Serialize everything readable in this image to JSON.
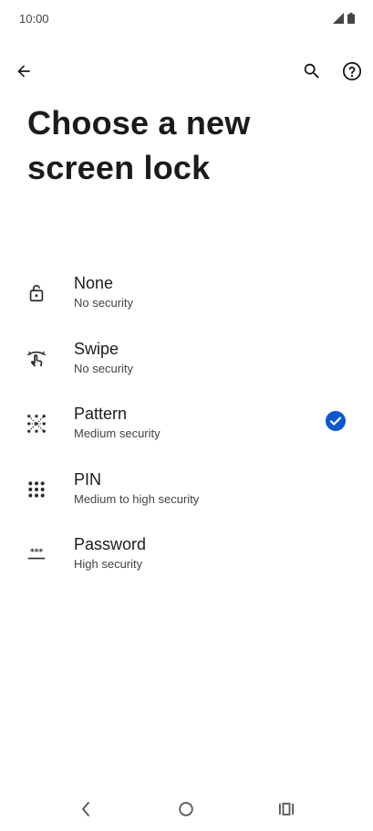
{
  "status_bar": {
    "time": "10:00",
    "icons": [
      "signal-icon",
      "battery-icon"
    ]
  },
  "app_bar": {
    "back_icon": "arrow-back-icon",
    "search_icon": "search-icon",
    "help_icon": "help-icon"
  },
  "page": {
    "title": "Choose a new screen lock"
  },
  "options": [
    {
      "label": "None",
      "summary": "No security",
      "icon": "unlock-icon",
      "selected": false
    },
    {
      "label": "Swipe",
      "summary": "No security",
      "icon": "swipe-icon",
      "selected": false
    },
    {
      "label": "Pattern",
      "summary": "Medium security",
      "icon": "pattern-icon",
      "selected": true
    },
    {
      "label": "PIN",
      "summary": "Medium to high security",
      "icon": "pin-icon",
      "selected": false
    },
    {
      "label": "Password",
      "summary": "High security",
      "icon": "password-icon",
      "selected": false
    }
  ],
  "nav_bar": {
    "icons": [
      "nav-back-icon",
      "nav-home-icon",
      "nav-recents-icon"
    ]
  },
  "colors": {
    "accent": "#0b57d0",
    "text_primary": "#1b1b1b",
    "text_secondary": "#444444",
    "background": "#ffffff"
  }
}
